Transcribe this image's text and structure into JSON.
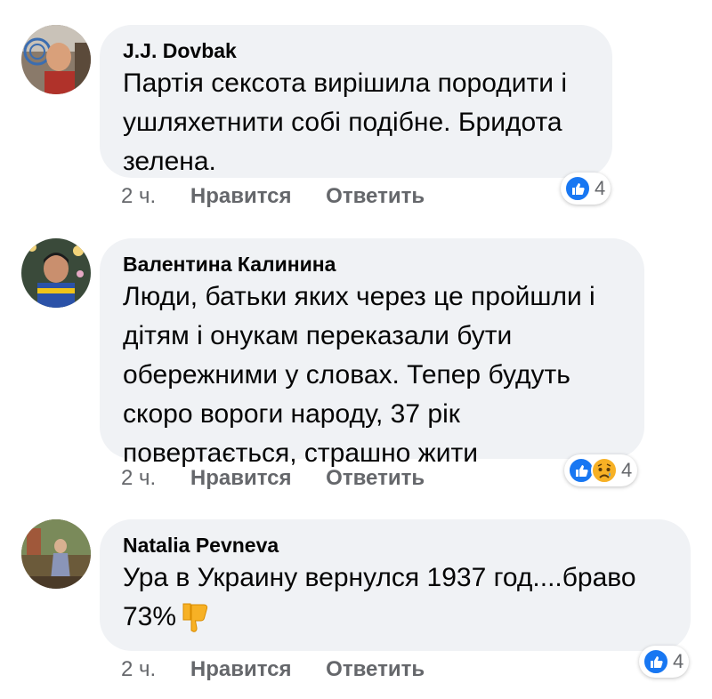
{
  "comments": [
    {
      "author": "J.J. Dovbak",
      "text": "Партія сексота вирішила породити і\nушляхетнити собі подібне. Бридота\nзелена.",
      "time": "2 ч.",
      "like_label": "Нравится",
      "reply_label": "Ответить",
      "reaction_count": "4",
      "reactions": [
        "like-icon"
      ]
    },
    {
      "author": "Валентина Калинина",
      "text": "Люди, батьки яких через це пройшли і\nдітям і онукам переказали бути\nобережними у словах. Тепер будуть\nскоро вороги народу, 37 рік\nповертається, страшно жити",
      "time": "2 ч.",
      "like_label": "Нравится",
      "reply_label": "Ответить",
      "reaction_count": "4",
      "reactions": [
        "like-icon",
        "sad-icon"
      ]
    },
    {
      "author": "Natalia Pevneva",
      "text_line1": "Ура  в Украину вернулся 1937 год....браво",
      "text_line2": "73%",
      "emoji": "thumbs-down-emoji",
      "time": "2 ч.",
      "like_label": "Нравится",
      "reply_label": "Ответить",
      "reaction_count": "4",
      "reactions": [
        "like-icon"
      ]
    }
  ],
  "colors": {
    "bubble": "#f0f2f5",
    "meta_text": "#65676b",
    "like_blue": "#1877f2",
    "sad_yellow": "#f7b125"
  }
}
